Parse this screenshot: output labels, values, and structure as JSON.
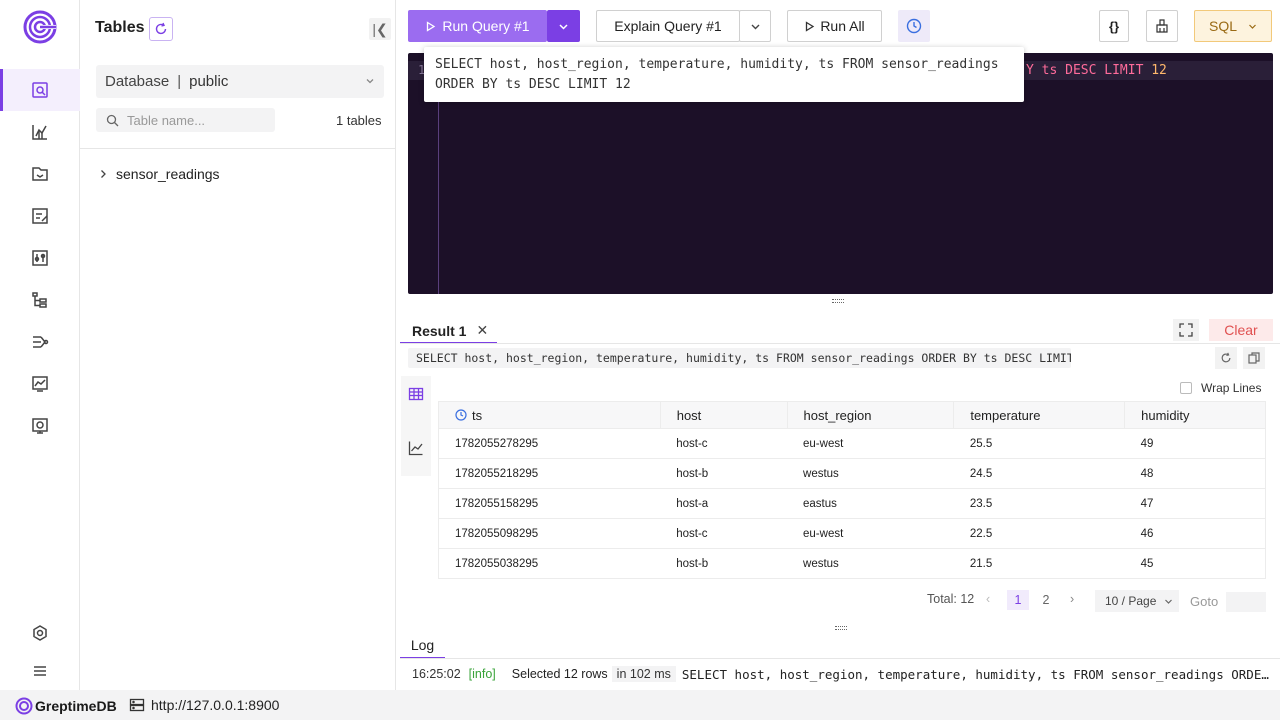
{
  "sidebar": {
    "title": "Tables",
    "database_label": "Database",
    "database_value": "public",
    "search_placeholder": "Table name...",
    "table_count": "1 tables",
    "tables": [
      "sensor_readings"
    ]
  },
  "toolbar": {
    "run_query": "Run Query #1",
    "explain_query": "Explain Query #1",
    "run_all": "Run All",
    "format_icon": "{}",
    "language": "SQL"
  },
  "editor": {
    "line_number": "1",
    "visible_code_tail_keyword": "Y ts DESC LIMIT",
    "visible_code_tail_number": "12",
    "tooltip": "SELECT host, host_region, temperature, humidity, ts FROM sensor_readings ORDER BY ts DESC LIMIT 12"
  },
  "results": {
    "tab_label": "Result 1",
    "clear_label": "Clear",
    "query": "SELECT host, host_region, temperature, humidity, ts FROM sensor_readings ORDER BY ts DESC LIMIT 12",
    "wrap_lines": "Wrap Lines",
    "columns": [
      "ts",
      "host",
      "host_region",
      "temperature",
      "humidity"
    ],
    "rows": [
      [
        "1782055278295",
        "host-c",
        "eu-west",
        "25.5",
        "49"
      ],
      [
        "1782055218295",
        "host-b",
        "westus",
        "24.5",
        "48"
      ],
      [
        "1782055158295",
        "host-a",
        "eastus",
        "23.5",
        "47"
      ],
      [
        "1782055098295",
        "host-c",
        "eu-west",
        "22.5",
        "46"
      ],
      [
        "1782055038295",
        "host-b",
        "westus",
        "21.5",
        "45"
      ]
    ],
    "total": "Total: 12",
    "pages": [
      "1",
      "2"
    ],
    "page_size": "10 / Page",
    "goto_label": "Goto"
  },
  "log": {
    "tab_label": "Log",
    "time": "16:25:02",
    "level": "[info]",
    "message": "Selected 12 rows",
    "duration": "in 102 ms",
    "sql": "SELECT host, host_region, temperature, humidity, ts FROM sensor_readings ORDER BY…"
  },
  "statusbar": {
    "brand": "GreptimeDB",
    "address": "http://127.0.0.1:8900"
  },
  "colors": {
    "accent": "#7b3fe4",
    "primary_button": "#9b6cf0",
    "editor_bg": "#1c1028",
    "clear_text": "#e05050",
    "log_info": "#3aa33a"
  }
}
